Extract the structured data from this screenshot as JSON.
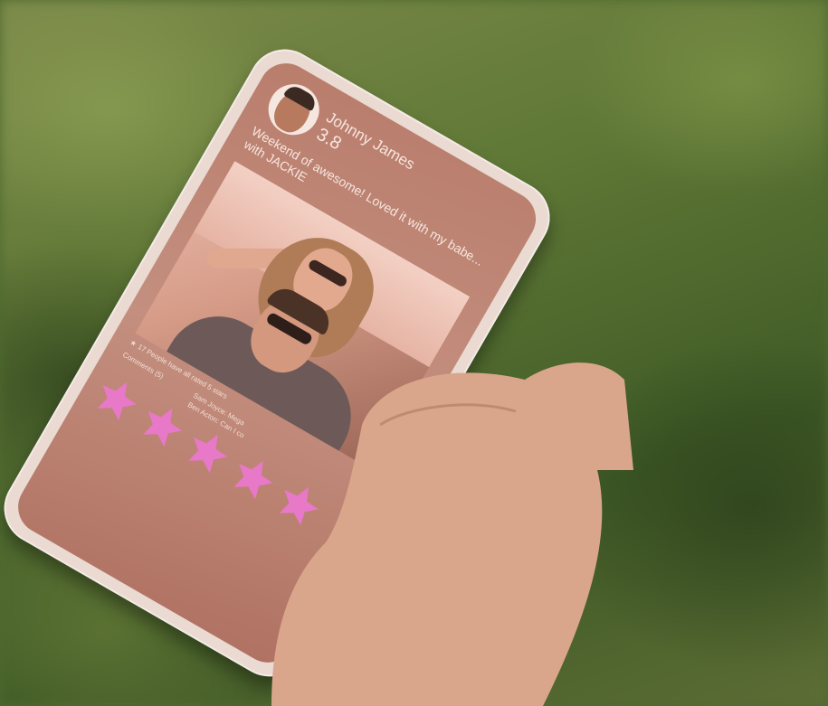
{
  "post": {
    "user_name": "Johnny James",
    "user_rating": "3.8",
    "caption": "Weekend of awesome! Loved it with my babe... with JACKIE",
    "rated_line": "17 People have all rated 5 stars",
    "comments_label": "Comments (5)",
    "comment_1": "Sam Joyce: Mega",
    "comment_2": "Ben Acton: Can I co"
  },
  "rating_widget": {
    "stars_filled": 5,
    "stars_total": 5,
    "star_color": "#e878c8"
  },
  "colors": {
    "screen_tint": "#c48f7f",
    "phone_frame": "#eadad2",
    "text_light": "#f7e6e0"
  },
  "icons": [
    "avatar-photo",
    "small-star-icon",
    "star-icon"
  ]
}
